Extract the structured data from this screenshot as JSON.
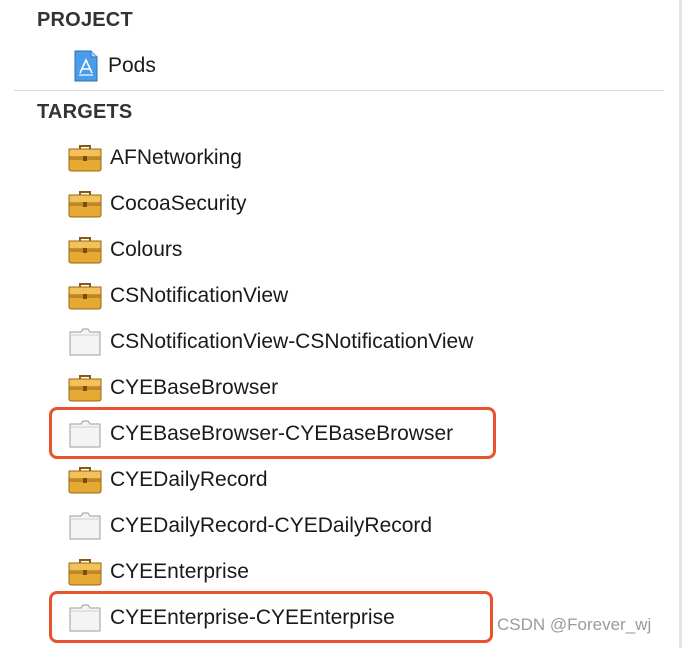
{
  "project": {
    "header": "PROJECT",
    "item": {
      "label": "Pods",
      "icon": "xcode-project-icon"
    }
  },
  "targets": {
    "header": "TARGETS",
    "items": [
      {
        "label": "AFNetworking",
        "icon": "toolbox-icon"
      },
      {
        "label": "CocoaSecurity",
        "icon": "toolbox-icon"
      },
      {
        "label": "Colours",
        "icon": "toolbox-icon"
      },
      {
        "label": "CSNotificationView",
        "icon": "toolbox-icon"
      },
      {
        "label": "CSNotificationView-CSNotificationView",
        "icon": "bundle-icon"
      },
      {
        "label": "CYEBaseBrowser",
        "icon": "toolbox-icon"
      },
      {
        "label": "CYEBaseBrowser-CYEBaseBrowser",
        "icon": "bundle-icon",
        "highlighted": true
      },
      {
        "label": "CYEDailyRecord",
        "icon": "toolbox-icon"
      },
      {
        "label": "CYEDailyRecord-CYEDailyRecord",
        "icon": "bundle-icon"
      },
      {
        "label": "CYEEnterprise",
        "icon": "toolbox-icon"
      },
      {
        "label": "CYEEnterprise-CYEEnterprise",
        "icon": "bundle-icon",
        "highlighted": true
      }
    ]
  },
  "colors": {
    "highlight": "#e8532d",
    "toolbox": "#e0a32c",
    "project_icon": "#3b8de0"
  },
  "watermark": "CSDN @Forever_wj"
}
